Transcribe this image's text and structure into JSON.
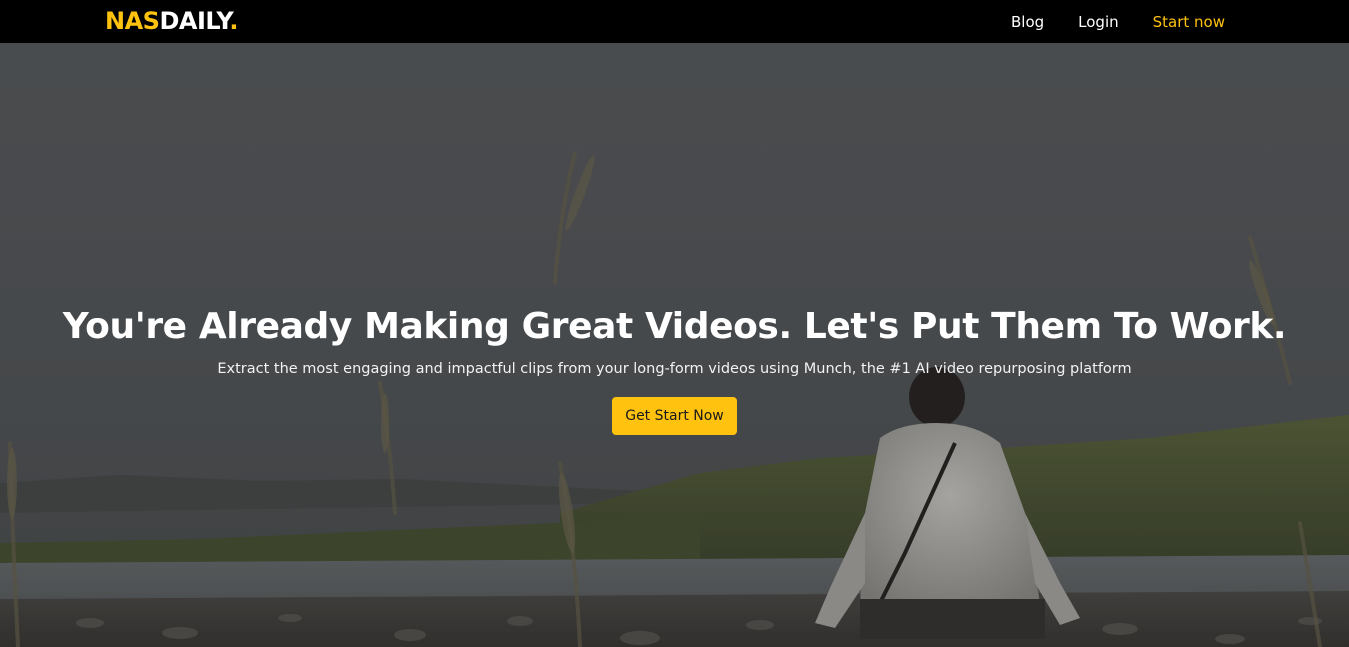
{
  "navbar": {
    "logo": {
      "part1": "NAS",
      "part2": "DAILY",
      "part3": "."
    },
    "links": [
      {
        "label": "Blog"
      },
      {
        "label": "Login"
      },
      {
        "label": "Start now"
      }
    ]
  },
  "hero": {
    "title": "You're Already Making Great Videos. Let's Put Them To Work.",
    "subtitle": "Extract the most engaging and impactful clips from your long-form videos using Munch, the #1 AI video repurposing platform",
    "cta_label": "Get Start Now"
  },
  "colors": {
    "accent": "#ffc20e",
    "navbar_bg": "#000000",
    "text": "#ffffff"
  }
}
